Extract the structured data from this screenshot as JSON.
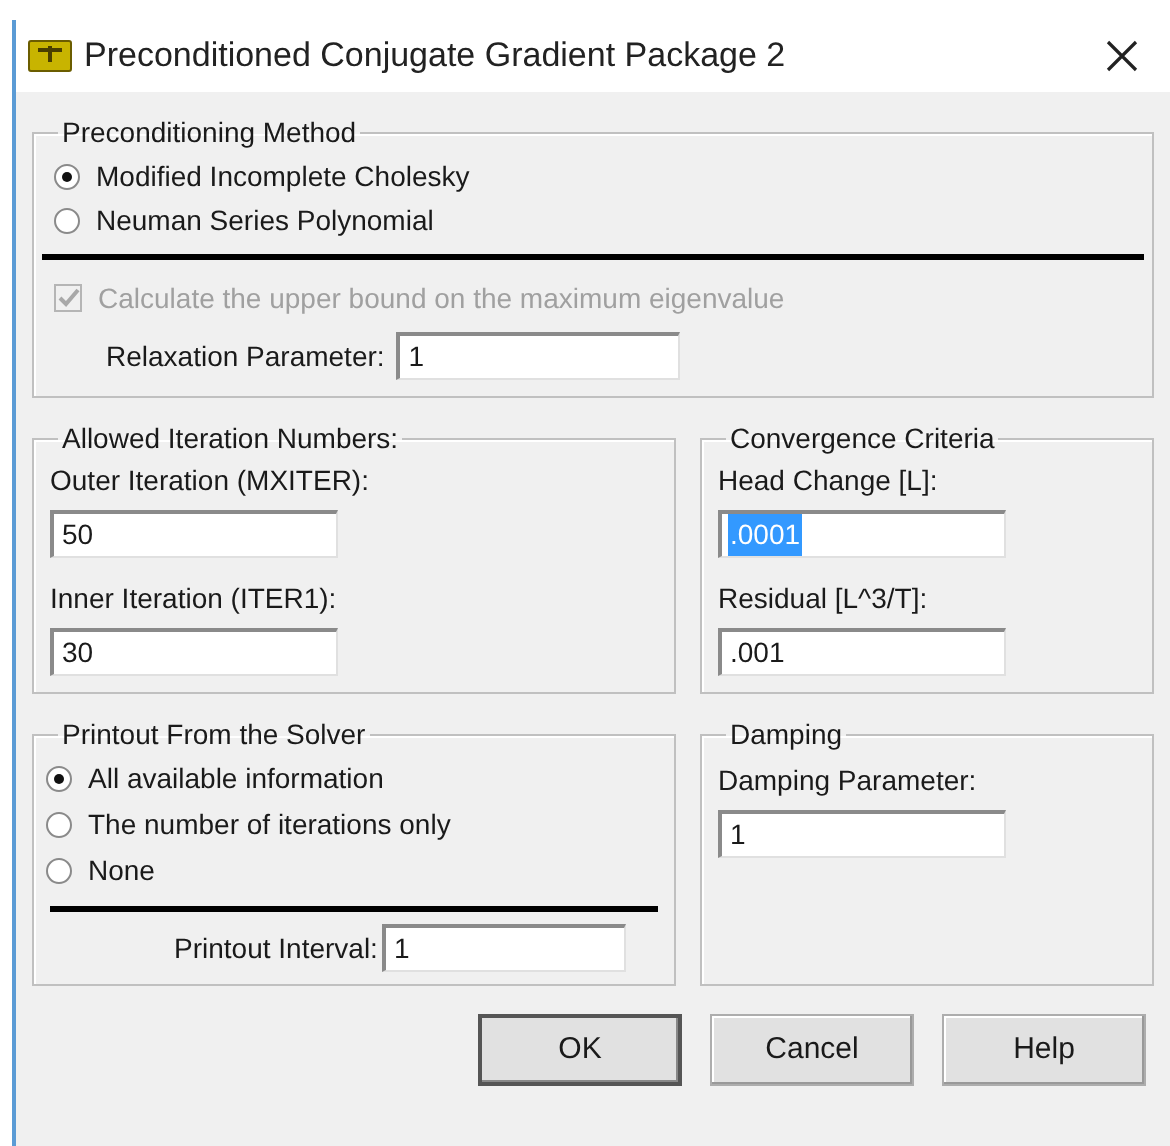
{
  "window": {
    "title": "Preconditioned Conjugate Gradient Package 2"
  },
  "preconditioning_method": {
    "title": "Preconditioning Method",
    "options": [
      {
        "label": "Modified Incomplete Cholesky",
        "selected": true
      },
      {
        "label": "Neuman Series Polynomial",
        "selected": false
      }
    ],
    "upper_bound": {
      "label": "Calculate the upper bound on the maximum eigenvalue",
      "checked": true,
      "disabled": true
    },
    "relaxation_parameter": {
      "label": "Relaxation Parameter:",
      "value": "1"
    }
  },
  "iteration_numbers": {
    "title": "Allowed Iteration Numbers:",
    "fields": [
      {
        "label": "Outer Iteration (MXITER):",
        "value": "50",
        "text_selected": false
      },
      {
        "label": "Inner Iteration (ITER1):",
        "value": "30",
        "text_selected": false
      }
    ]
  },
  "convergence_criteria": {
    "title": "Convergence Criteria",
    "fields": [
      {
        "label": "Head Change [L]:",
        "value": ".0001",
        "text_selected": true
      },
      {
        "label": "Residual [L^3/T]:",
        "value": ".001",
        "text_selected": false
      }
    ]
  },
  "printout": {
    "title": "Printout From the Solver",
    "options": [
      {
        "label": "All available information",
        "selected": true
      },
      {
        "label": "The number of iterations only",
        "selected": false
      },
      {
        "label": "None",
        "selected": false
      }
    ],
    "interval": {
      "label": "Printout Interval:",
      "value": "1"
    }
  },
  "damping": {
    "title": "Damping",
    "fields": [
      {
        "label": "Damping Parameter:",
        "value": "1",
        "text_selected": false
      }
    ]
  },
  "buttons": [
    {
      "label": "OK",
      "default": true
    },
    {
      "label": "Cancel",
      "default": false
    },
    {
      "label": "Help",
      "default": false
    }
  ]
}
